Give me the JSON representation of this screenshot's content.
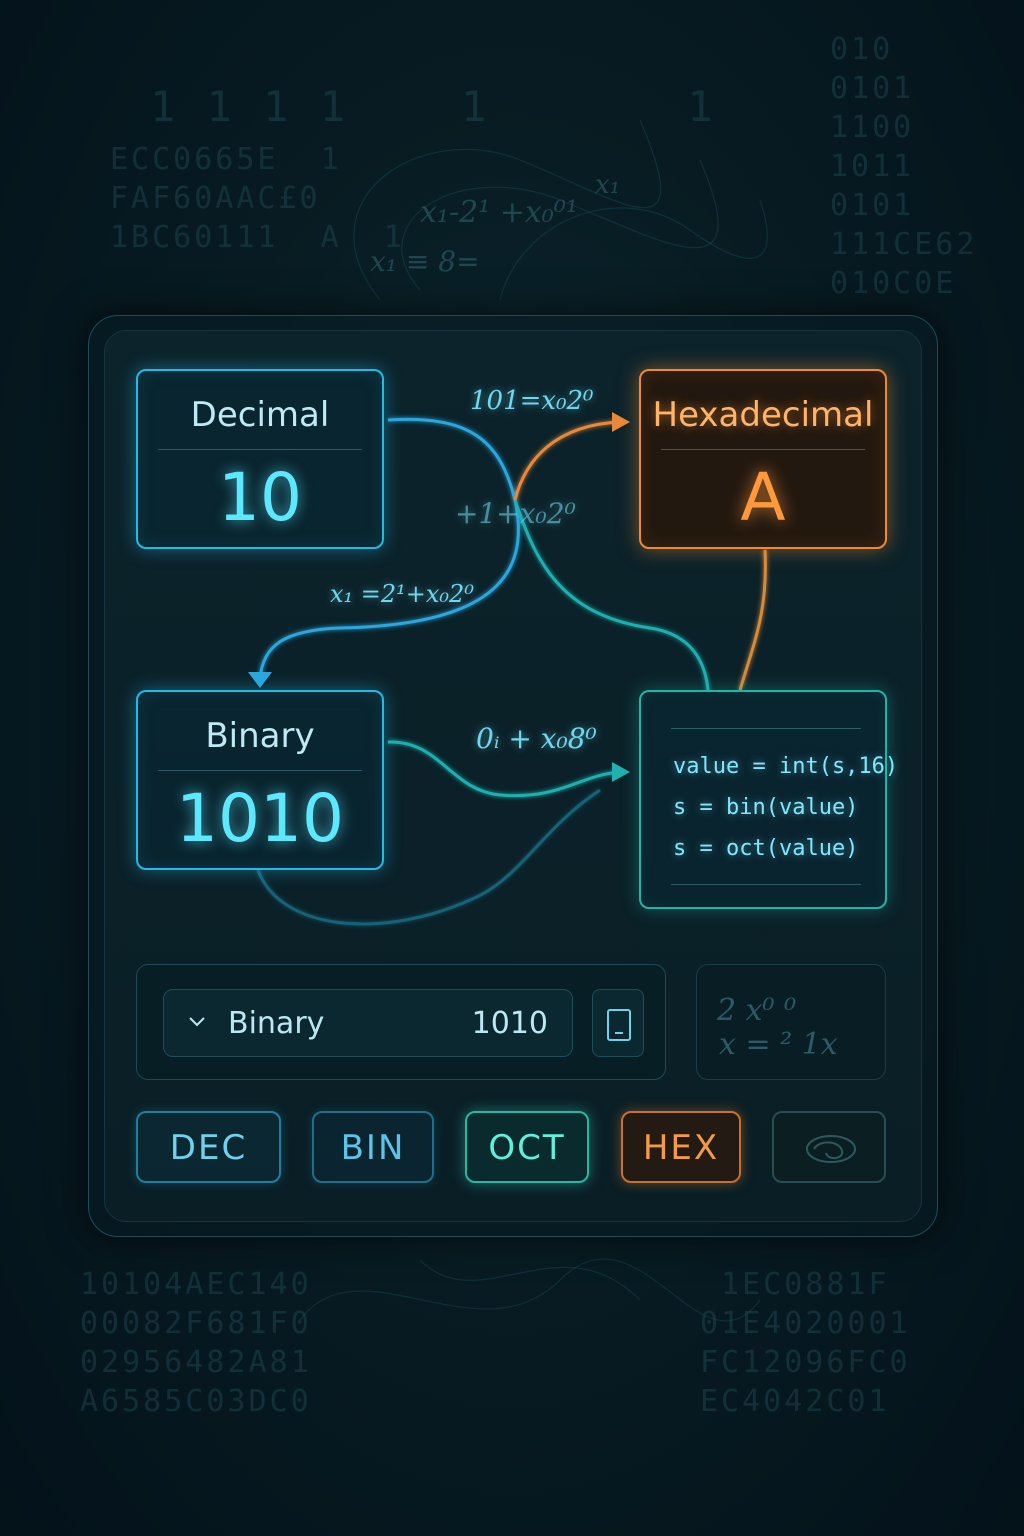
{
  "cards": {
    "decimal": {
      "title": "Decimal",
      "value": "10"
    },
    "hexadecimal": {
      "title": "Hexadecimal",
      "value": "A"
    },
    "binary": {
      "title": "Binary",
      "value": "1010"
    }
  },
  "code": {
    "lines": [
      "value = int(s,16)",
      "s = bin(value)",
      "s = oct(value)"
    ]
  },
  "formulas": {
    "f1": "101=x₀2⁰",
    "f2": "+1+x₀2⁰",
    "f3": "x₁ =2¹+x₀2⁰",
    "f4": "0ᵢ + x₀8⁰"
  },
  "converter": {
    "selected_base": "Binary",
    "value": "1010"
  },
  "mode_buttons": [
    "DEC",
    "BIN",
    "OCT",
    "HEX"
  ],
  "colors": {
    "cyan": "#26b9e6",
    "orange": "#f08a2e",
    "teal": "#21b4a8",
    "background": "#081c23"
  },
  "icons": {
    "dropdown": "chevron-down-icon",
    "copy": "copy-icon",
    "swirl": "swirl-icon"
  }
}
